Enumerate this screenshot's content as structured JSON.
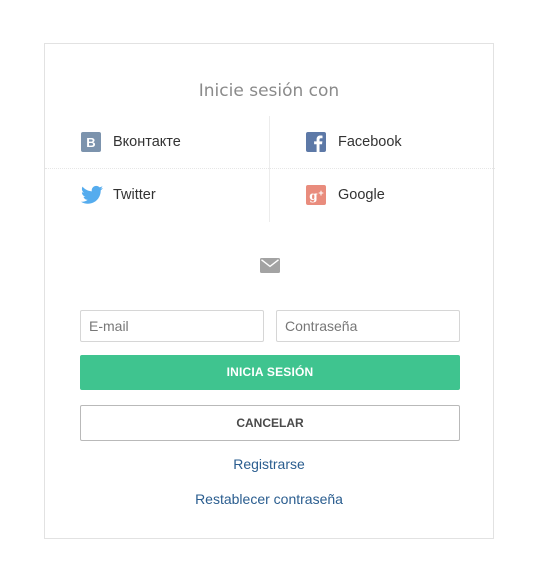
{
  "login": {
    "heading": "Inicie sesión con",
    "social": [
      {
        "label": "Вконтакте",
        "icon": "vk-icon",
        "color": "#7c93ad"
      },
      {
        "label": "Facebook",
        "icon": "facebook-icon",
        "color": "#5d79a7"
      },
      {
        "label": "Twitter",
        "icon": "twitter-icon",
        "color": "#55acee"
      },
      {
        "label": "Google",
        "icon": "google-plus-icon",
        "color": "#e98c7d"
      }
    ],
    "email_placeholder": "E-mail",
    "password_placeholder": "Contraseña",
    "login_button": "INICIA SESIÓN",
    "cancel_button": "CANCELAR",
    "register_link": "Registrarse",
    "reset_link": "Restablecer contraseña",
    "accent_color": "#3fc48f",
    "link_color": "#2a5d8f"
  }
}
